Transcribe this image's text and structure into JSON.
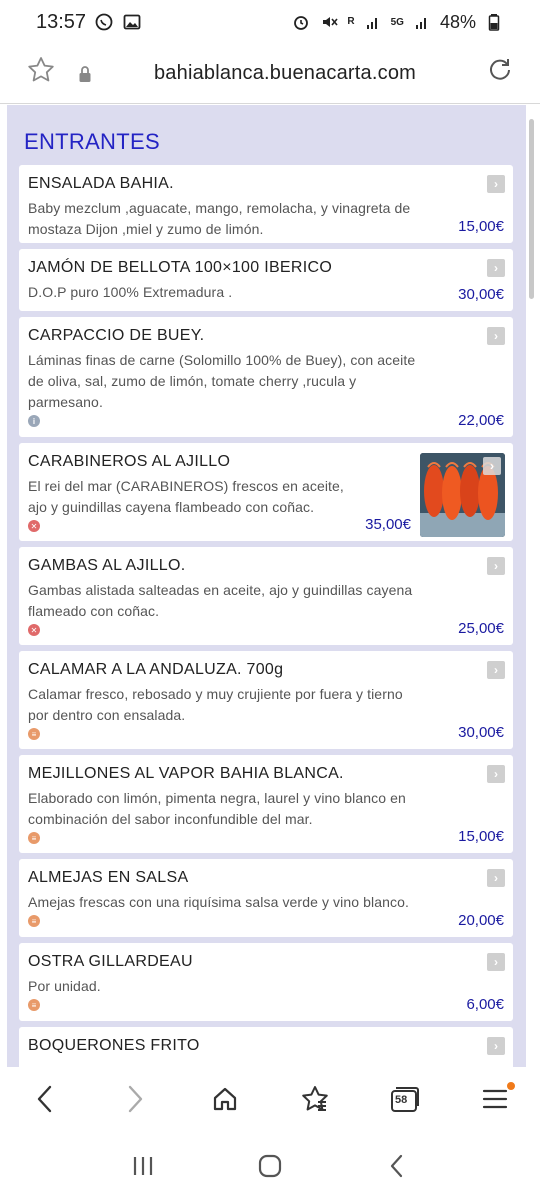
{
  "status": {
    "time": "13:57",
    "battery": "48%",
    "net_label": "5G",
    "r_label": "R"
  },
  "browser": {
    "url": "bahiablanca.buenacarta.com",
    "tabs_count": "58"
  },
  "menu": {
    "section_title": "ENTRANTES",
    "items": [
      {
        "name": "ENSALADA BAHIA.",
        "desc": "Baby mezclum ,aguacate, mango, remolacha, y vinagreta de mostaza Dijon ,miel y zumo de limón.",
        "price": "15,00€"
      },
      {
        "name": "JAMÓN DE BELLOTA 100×100 IBERICO",
        "desc": "D.O.P puro 100% Extremadura .",
        "price": "30,00€"
      },
      {
        "name": "CARPACCIO DE BUEY.",
        "desc": "Láminas finas de carne (Solomillo 100% de Buey), con aceite de oliva, sal, zumo de limón, tomate cherry ,rucula y parmesano.",
        "price": "22,00€"
      },
      {
        "name": "CARABINEROS AL AJILLO",
        "desc": "El rei del mar (CARABINEROS) frescos en aceite, ajo y guindillas cayena flambeado con coñac.",
        "price": "35,00€"
      },
      {
        "name": "GAMBAS AL AJILLO.",
        "desc": "Gambas alistada salteadas en aceite, ajo y guindillas cayena flameado con coñac.",
        "price": "25,00€"
      },
      {
        "name": "CALAMAR A LA ANDALUZA. 700g",
        "desc": "Calamar fresco, rebosado y muy crujiente por fuera y tierno por dentro con ensalada.",
        "price": "30,00€"
      },
      {
        "name": "MEJILLONES AL VAPOR BAHIA BLANCA.",
        "desc": "Elaborado con limón, pimenta negra, laurel y vino blanco en combinación del sabor inconfundible del mar.",
        "price": "15,00€"
      },
      {
        "name": "ALMEJAS EN SALSA",
        "desc": "Amejas frescas con una riquísima salsa verde y vino blanco.",
        "price": "20,00€"
      },
      {
        "name": "OSTRA GILLARDEAU",
        "desc": "Por unidad.",
        "price": "6,00€"
      },
      {
        "name": "BOQUERONES FRITO",
        "desc": "",
        "price": ""
      }
    ]
  },
  "colors": {
    "section_title": "#2424c4",
    "price": "#1a1aa0",
    "background": "#dcdcef",
    "notification_dot": "#f07a1a"
  },
  "icons": {
    "whatsapp": "whatsapp-icon",
    "gallery": "gallery-icon",
    "alarm": "alarm-icon",
    "mute": "mute-icon",
    "favorite": "star-icon",
    "lock": "lock-icon",
    "reload": "reload-icon",
    "back": "chevron-left-icon",
    "forward": "chevron-right-icon",
    "home": "home-icon",
    "bookmarks": "bookmarks-icon",
    "tabs": "tabs-icon",
    "menu": "hamburger-icon"
  }
}
